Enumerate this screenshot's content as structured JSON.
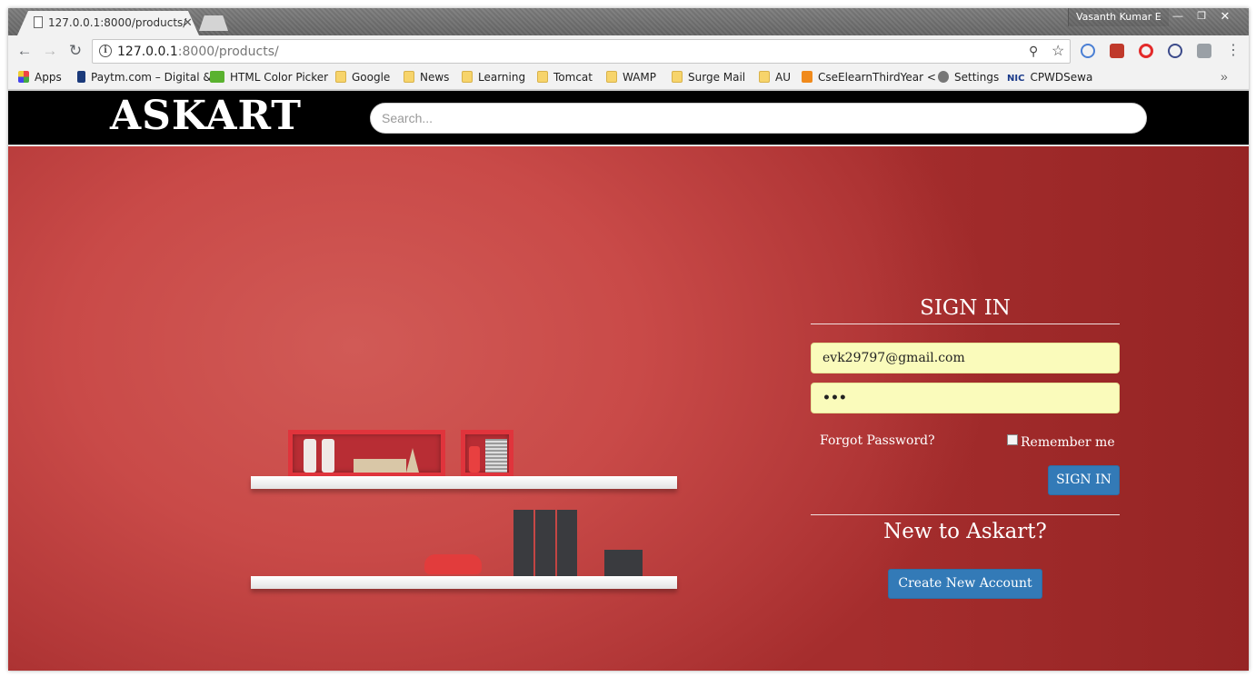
{
  "browser": {
    "tab_title": "127.0.0.1:8000/products/",
    "tab_close": "✕",
    "profile_name": "Vasanth Kumar E",
    "url_host": "127.0.0.1",
    "url_rest": ":8000/products/",
    "bookmarks": [
      {
        "label": "Apps",
        "icon": "apps-grid-icon"
      },
      {
        "label": "Paytm.com – Digital &",
        "icon": "paytm-icon"
      },
      {
        "label": "HTML Color Picker",
        "icon": "w3-icon"
      },
      {
        "label": "Google",
        "icon": "folder-icon"
      },
      {
        "label": "News",
        "icon": "folder-icon"
      },
      {
        "label": "Learning",
        "icon": "folder-icon"
      },
      {
        "label": "Tomcat",
        "icon": "folder-icon"
      },
      {
        "label": "WAMP",
        "icon": "folder-icon"
      },
      {
        "label": "Surge Mail",
        "icon": "folder-icon"
      },
      {
        "label": "AU",
        "icon": "folder-icon"
      },
      {
        "label": "CseElearnThirdYear <",
        "icon": "t-icon"
      },
      {
        "label": "Settings",
        "icon": "gear-icon"
      },
      {
        "label": "CPWDSewa",
        "icon": "nic-icon"
      }
    ],
    "nic_badge": "NIC",
    "more": "»"
  },
  "site": {
    "logo": "ASKART",
    "search_placeholder": "Search..."
  },
  "signin": {
    "title": "SIGN IN",
    "email_value": "evk29797@gmail.com",
    "password_value": "•••",
    "forgot_label": "Forgot Password?",
    "remember_label": "Remember me",
    "remember_checked": false,
    "submit_label": "SIGN IN",
    "new_title": "New to Askart?",
    "create_label": "Create New Account"
  },
  "colors": {
    "hero": "#c94a48",
    "button": "#337ab7",
    "field_bg": "#fafbbb"
  }
}
